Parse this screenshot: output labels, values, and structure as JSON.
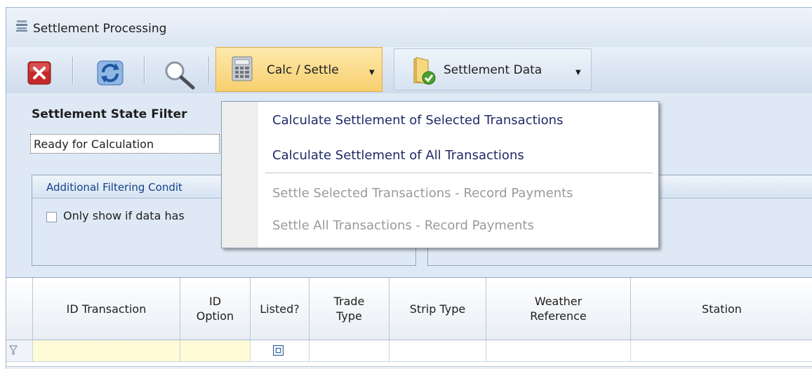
{
  "window": {
    "title": "Settlement Processing"
  },
  "toolbar": {
    "calc_label": "Calc / Settle",
    "settlement_data_label": "Settlement Data"
  },
  "filter": {
    "title": "Settlement State Filter",
    "selected": "Ready for Calculation",
    "group_title": "Additional Filtering Condit",
    "checkbox_label": "Only show if data has"
  },
  "dropdown": {
    "items": [
      {
        "label": "Calculate Settlement of Selected Transactions",
        "enabled": true
      },
      {
        "label": "Calculate Settlement of All Transactions",
        "enabled": true
      },
      {
        "label": "Settle Selected Transactions - Record Payments",
        "enabled": false
      },
      {
        "label": "Settle All Transactions - Record Payments",
        "enabled": false
      }
    ]
  },
  "grid": {
    "columns": [
      "ID Transaction",
      "ID Option",
      "Listed?",
      "Trade Type",
      "Strip Type",
      "Weather Reference",
      "Station"
    ]
  },
  "colors": {
    "accent_orange": "#f8cf6e",
    "window_bg": "#dfe9f5",
    "filter_row_yellow": "#fefbd6",
    "menu_text": "#1f2a66",
    "disabled_text": "#9a9a9a"
  }
}
